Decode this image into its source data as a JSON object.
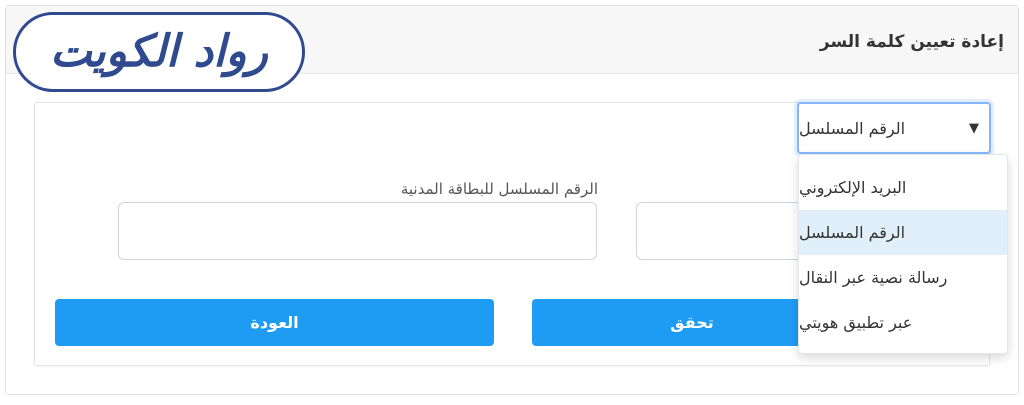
{
  "header": {
    "title": "إعادة تعيين كلمة السر",
    "logo_text": "رواد الكويت"
  },
  "form": {
    "method_select": {
      "value": "الرقم المسلسل",
      "options": [
        "البريد الإلكتروني",
        "الرقم المسلسل",
        "رسالة نصية عبر النقال",
        "عبر تطبيق هويتي"
      ],
      "selected_index": 1
    },
    "civil_serial_label": "الرقم المسلسل للبطاقة المدنية",
    "verify_label": "تحقق",
    "back_label": "العودة"
  },
  "colors": {
    "logo_blue": "#2f4a8f",
    "button_blue": "#1e9cf4",
    "selected_option": "#e1effa"
  }
}
